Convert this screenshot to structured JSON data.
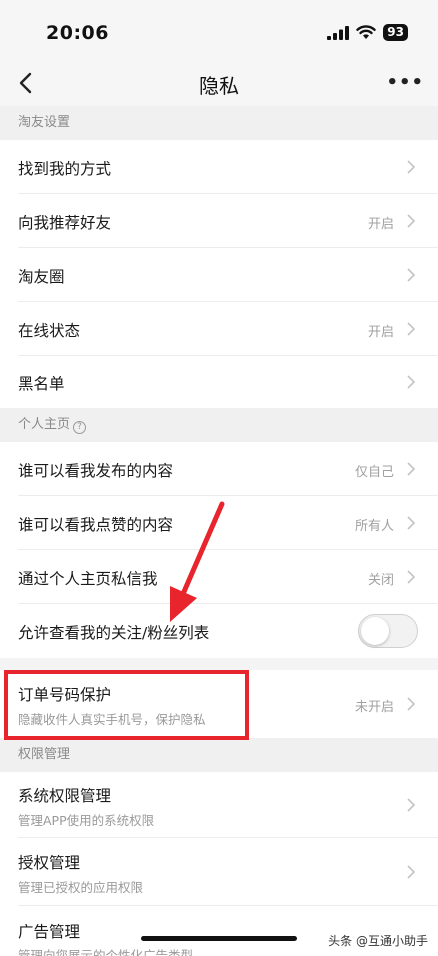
{
  "status_bar": {
    "time": "20:06",
    "battery": "93"
  },
  "nav": {
    "title": "隐私",
    "more": "•••"
  },
  "sections": {
    "taoyou": "淘友设置",
    "homepage": "个人主页",
    "permissions": "权限管理"
  },
  "rows": {
    "find_me": {
      "label": "找到我的方式"
    },
    "recommend": {
      "label": "向我推荐好友",
      "value": "开启"
    },
    "circle": {
      "label": "淘友圈"
    },
    "online": {
      "label": "在线状态",
      "value": "开启"
    },
    "blacklist": {
      "label": "黑名单"
    },
    "posts": {
      "label": "谁可以看我发布的内容",
      "value": "仅自己"
    },
    "likes": {
      "label": "谁可以看我点赞的内容",
      "value": "所有人"
    },
    "dm": {
      "label": "通过个人主页私信我",
      "value": "关闭"
    },
    "follow_list": {
      "label": "允许查看我的关注/粉丝列表",
      "toggle_on": false
    },
    "order_phone": {
      "label": "订单号码保护",
      "sub": "隐藏收件人真实手机号，保护隐私",
      "value": "未开启"
    },
    "system_perm": {
      "label": "系统权限管理",
      "sub": "管理APP使用的系统权限"
    },
    "auth": {
      "label": "授权管理",
      "sub": "管理已授权的应用权限"
    },
    "ads": {
      "label": "广告管理",
      "sub": "管理向您展示的个性化广告类型"
    }
  },
  "watermark": "头条 @互通小助手",
  "colors": {
    "highlight": "#e8242d",
    "arrow": "#e8242d"
  }
}
